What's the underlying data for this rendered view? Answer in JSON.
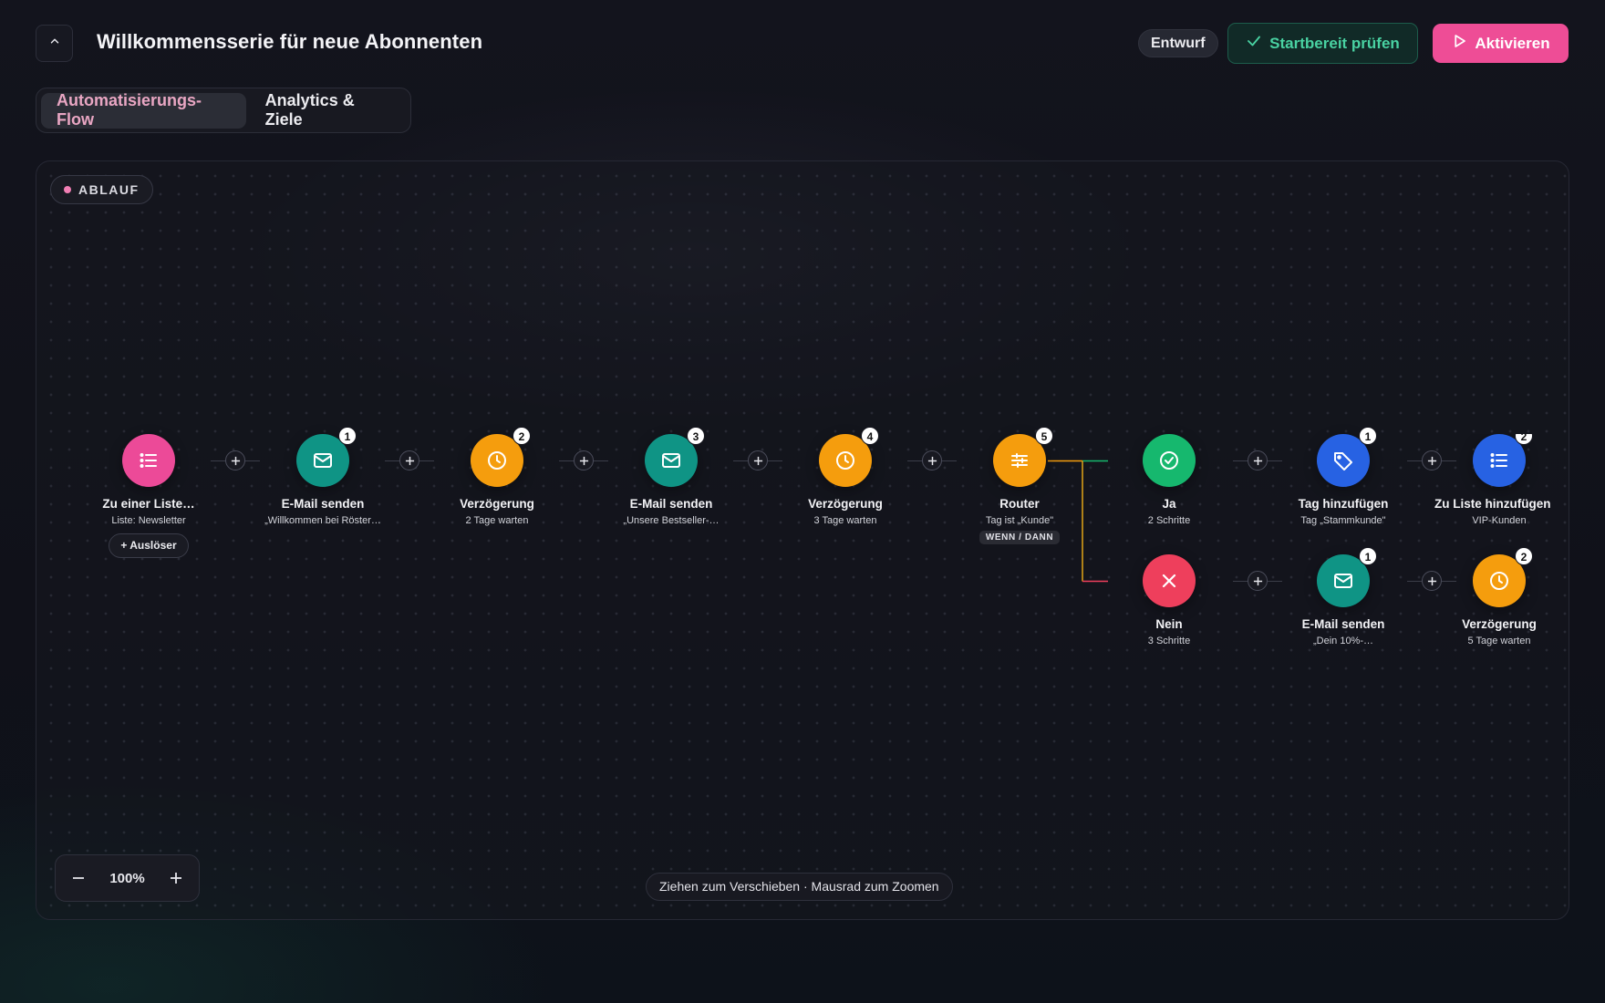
{
  "header": {
    "title": "Willkommensserie für neue Abonnenten",
    "status": "Entwurf",
    "check_label": "Startbereit prüfen",
    "activate_label": "Aktivieren"
  },
  "tabs": [
    {
      "label": "Automatisierungs-Flow",
      "active": true
    },
    {
      "label": "Analytics & Ziele",
      "active": false
    }
  ],
  "canvas": {
    "section_label": "ABLAUF",
    "zoom": "100%",
    "hint": "Ziehen zum Verschieben · Mausrad zum Zoomen"
  },
  "main_flow": [
    {
      "icon": "list-icon",
      "color": "#ec4a98",
      "title": "Zu einer Liste…",
      "sub": "Liste: Newsletter",
      "extra_button": "Auslöser"
    },
    {
      "icon": "mail-icon",
      "color": "#0f9485",
      "badge": "1",
      "title": "E-Mail senden",
      "sub": "„Willkommen bei Röster…"
    },
    {
      "icon": "clock-icon",
      "color": "#f59d0d",
      "badge": "2",
      "title": "Verzögerung",
      "sub": "2 Tage warten"
    },
    {
      "icon": "mail-icon",
      "color": "#0f9485",
      "badge": "3",
      "title": "E-Mail senden",
      "sub": "„Unsere Bestseller-…"
    },
    {
      "icon": "clock-icon",
      "color": "#f59d0d",
      "badge": "4",
      "title": "Verzögerung",
      "sub": "3 Tage warten"
    },
    {
      "icon": "sliders-icon",
      "color": "#f59d0d",
      "badge": "5",
      "title": "Router",
      "sub": "Tag ist „Kunde\"",
      "tag": "WENN / DANN"
    }
  ],
  "branch_yes": [
    {
      "icon": "check-circle-icon",
      "color": "#16b86e",
      "title": "Ja",
      "sub": "2 Schritte"
    },
    {
      "icon": "tag-icon",
      "color": "#2762e3",
      "badge": "1",
      "title": "Tag hinzufügen",
      "sub": "Tag „Stammkunde\""
    },
    {
      "icon": "list-icon",
      "color": "#2762e3",
      "badge": "2",
      "title": "Zu Liste hinzufügen",
      "sub": "VIP-Kunden"
    }
  ],
  "branch_no": [
    {
      "icon": "x-icon",
      "color": "#ee3f5c",
      "title": "Nein",
      "sub": "3 Schritte"
    },
    {
      "icon": "mail-icon",
      "color": "#0f9485",
      "badge": "1",
      "title": "E-Mail senden",
      "sub": "„Dein 10%-…"
    },
    {
      "icon": "clock-icon",
      "color": "#f59d0d",
      "badge": "2",
      "title": "Verzögerung",
      "sub": "5 Tage warten"
    }
  ],
  "colors": {
    "accent": "#ee4d96",
    "success": "#49d2a2",
    "branch_yes_line": "#16b86e",
    "branch_no_line": "#ee3f5c",
    "router_line": "#f59d0d"
  }
}
